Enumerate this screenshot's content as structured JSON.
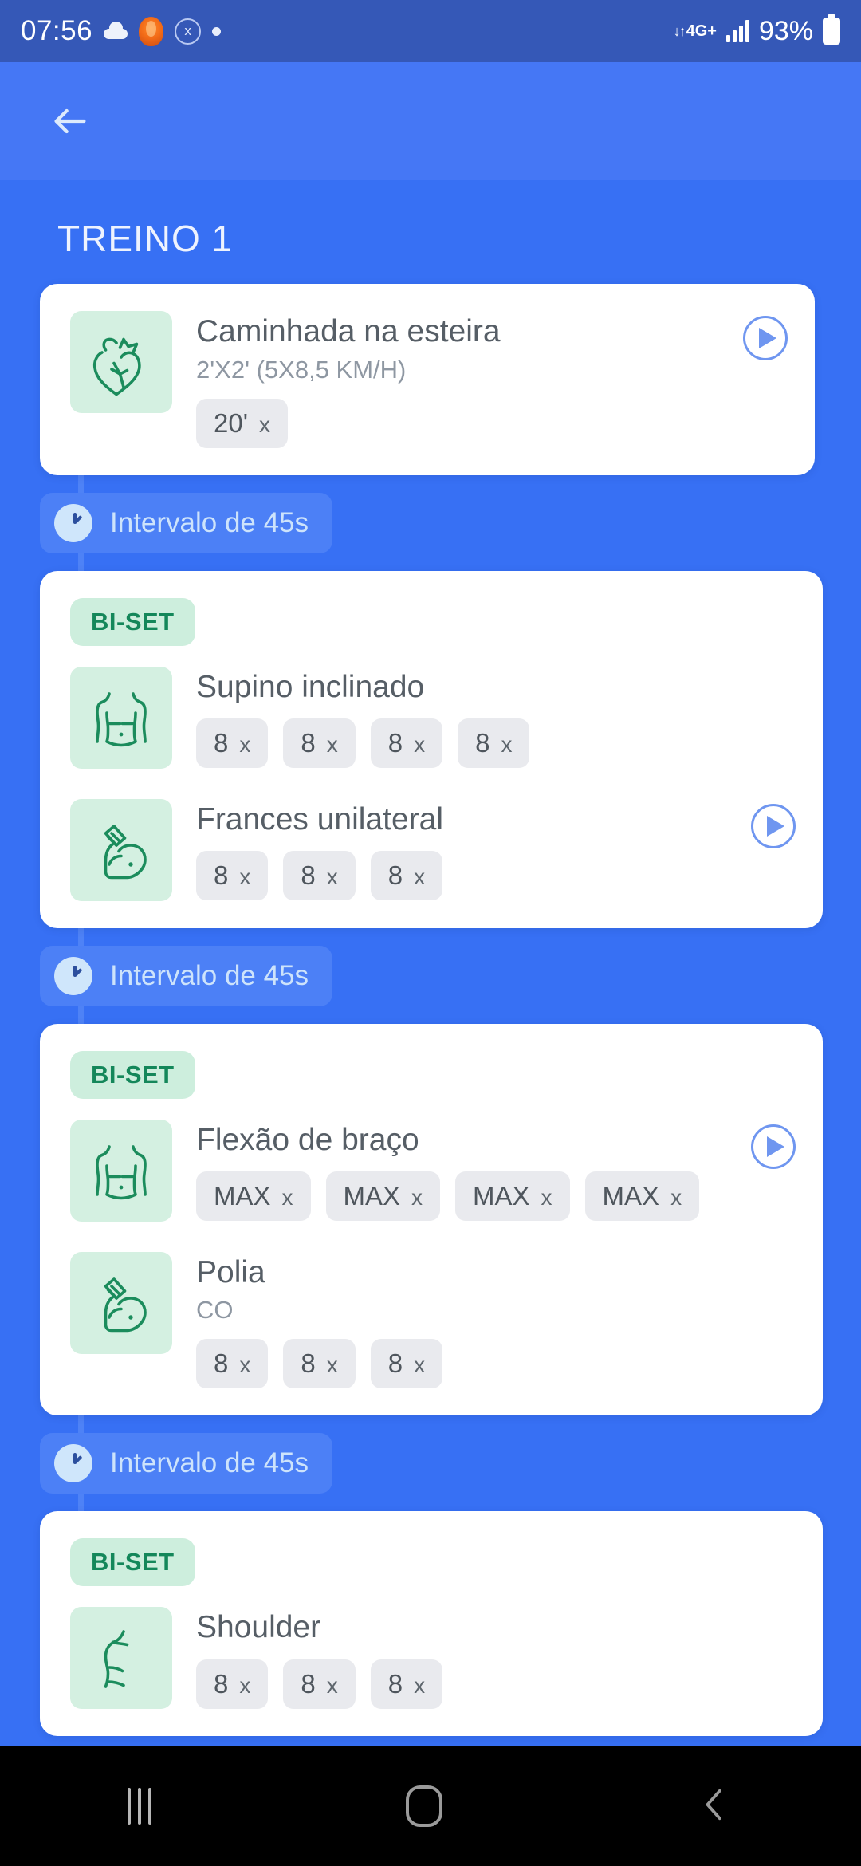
{
  "statusbar": {
    "time": "07:56",
    "network": "4G+",
    "battery_percent": "93%",
    "icons": [
      "cloud-icon",
      "orange-app-icon",
      "x-circle-icon",
      "dot-icon",
      "data-transfer-icon",
      "signal-bars-icon",
      "battery-icon"
    ]
  },
  "toolbar": {
    "back_icon": "arrow-left-icon"
  },
  "page": {
    "title": "TREINO 1"
  },
  "colors": {
    "primary_blue": "#3770f4",
    "toolbar_blue": "#4577f5",
    "statusbar_blue": "#3558b7",
    "mint": "#d4f0e1",
    "green_text": "#14875a",
    "chip_gray": "#e9eaee",
    "play_blue": "#6f96f0"
  },
  "blocks": [
    {
      "type": "card",
      "tag": null,
      "has_play": true,
      "exercises": [
        {
          "icon": "heart-icon",
          "name": "Caminhada na esteira",
          "subtitle": "2'X2' (5X8,5 KM/H)",
          "sets": [
            {
              "reps": "20'",
              "unit": "x"
            }
          ],
          "play": true
        }
      ]
    },
    {
      "type": "interval",
      "icon": "clock-icon",
      "label": "Intervalo de 45s"
    },
    {
      "type": "card",
      "tag": "BI-SET",
      "exercises": [
        {
          "icon": "chest-icon",
          "name": "Supino inclinado",
          "subtitle": null,
          "sets": [
            {
              "reps": "8",
              "unit": "x"
            },
            {
              "reps": "8",
              "unit": "x"
            },
            {
              "reps": "8",
              "unit": "x"
            },
            {
              "reps": "8",
              "unit": "x"
            }
          ],
          "play": false
        },
        {
          "icon": "biceps-icon",
          "name": "Frances unilateral",
          "subtitle": null,
          "sets": [
            {
              "reps": "8",
              "unit": "x"
            },
            {
              "reps": "8",
              "unit": "x"
            },
            {
              "reps": "8",
              "unit": "x"
            }
          ],
          "play": true
        }
      ]
    },
    {
      "type": "interval",
      "icon": "clock-icon",
      "label": "Intervalo de 45s"
    },
    {
      "type": "card",
      "tag": "BI-SET",
      "exercises": [
        {
          "icon": "chest-icon",
          "name": "Flexão de braço",
          "subtitle": null,
          "sets": [
            {
              "reps": "MAX",
              "unit": "x"
            },
            {
              "reps": "MAX",
              "unit": "x"
            },
            {
              "reps": "MAX",
              "unit": "x"
            },
            {
              "reps": "MAX",
              "unit": "x"
            }
          ],
          "play": true
        },
        {
          "icon": "biceps-icon",
          "name": "Polia",
          "subtitle": "CO",
          "sets": [
            {
              "reps": "8",
              "unit": "x"
            },
            {
              "reps": "8",
              "unit": "x"
            },
            {
              "reps": "8",
              "unit": "x"
            }
          ],
          "play": false
        }
      ]
    },
    {
      "type": "interval",
      "icon": "clock-icon",
      "label": "Intervalo de 45s"
    },
    {
      "type": "card",
      "tag": "BI-SET",
      "exercises": [
        {
          "icon": "shoulder-icon",
          "name": "Shoulder",
          "subtitle": null,
          "sets": [
            {
              "reps": "8",
              "unit": "x"
            },
            {
              "reps": "8",
              "unit": "x"
            },
            {
              "reps": "8",
              "unit": "x"
            }
          ],
          "play": false
        }
      ]
    }
  ],
  "navbar": {
    "recents": "recents-icon",
    "home": "home-icon",
    "back": "back-icon"
  }
}
